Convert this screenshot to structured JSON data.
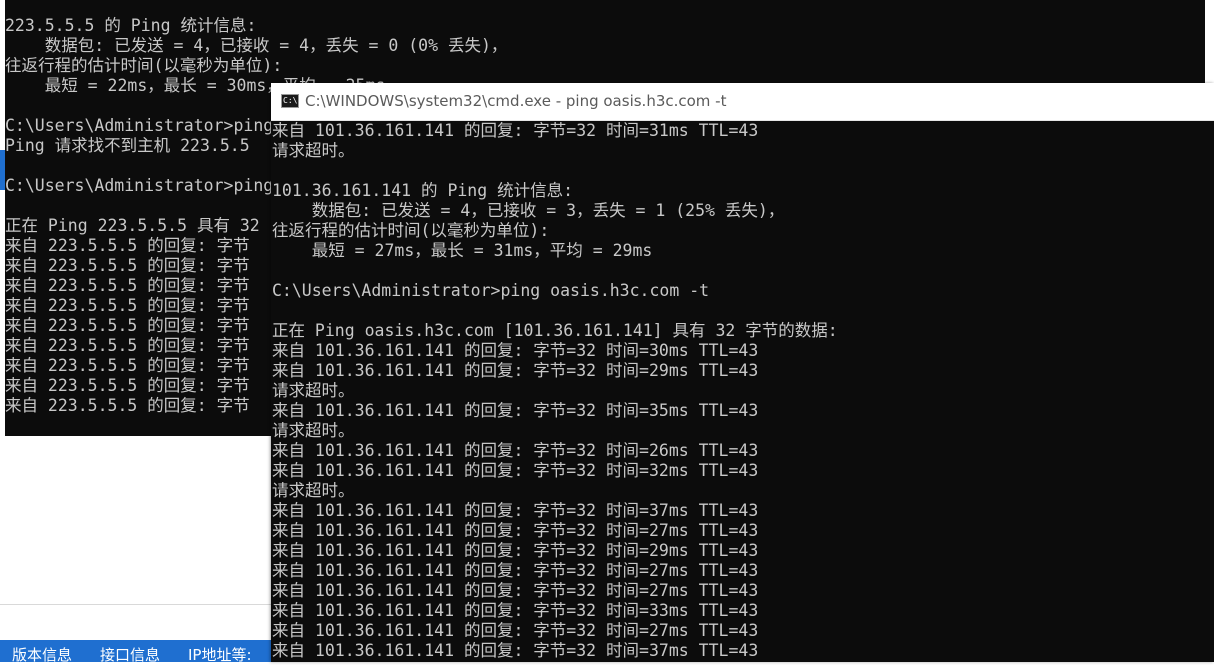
{
  "back_console": {
    "lines": [
      "223.5.5.5 的 Ping 统计信息:",
      "    数据包: 已发送 = 4，已接收 = 4，丢失 = 0 (0% 丢失)，",
      "往返行程的估计时间(以毫秒为单位):",
      "    最短 = 22ms，最长 = 30ms，平均 = 25ms",
      "",
      "C:\\Users\\Administrator>ping",
      "Ping 请求找不到主机 223.5.5",
      "",
      "C:\\Users\\Administrator>ping",
      "",
      "正在 Ping 223.5.5.5 具有 32",
      "来自 223.5.5.5 的回复: 字节",
      "来自 223.5.5.5 的回复: 字节",
      "来自 223.5.5.5 的回复: 字节",
      "来自 223.5.5.5 的回复: 字节",
      "来自 223.5.5.5 的回复: 字节",
      "来自 223.5.5.5 的回复: 字节",
      "来自 223.5.5.5 的回复: 字节",
      "来自 223.5.5.5 的回复: 字节",
      "来自 223.5.5.5 的回复: 字节"
    ]
  },
  "front_window": {
    "title": "C:\\WINDOWS\\system32\\cmd.exe - ping  oasis.h3c.com -t",
    "icon_label": "C:\\",
    "lines": [
      "来自 101.36.161.141 的回复: 字节=32 时间=31ms TTL=43",
      "请求超时。",
      "",
      "101.36.161.141 的 Ping 统计信息:",
      "    数据包: 已发送 = 4，已接收 = 3，丢失 = 1 (25% 丢失)，",
      "往返行程的估计时间(以毫秒为单位):",
      "    最短 = 27ms，最长 = 31ms，平均 = 29ms",
      "",
      "C:\\Users\\Administrator>ping oasis.h3c.com -t",
      "",
      "正在 Ping oasis.h3c.com [101.36.161.141] 具有 32 字节的数据:",
      "来自 101.36.161.141 的回复: 字节=32 时间=30ms TTL=43",
      "来自 101.36.161.141 的回复: 字节=32 时间=29ms TTL=43",
      "请求超时。",
      "来自 101.36.161.141 的回复: 字节=32 时间=35ms TTL=43",
      "请求超时。",
      "来自 101.36.161.141 的回复: 字节=32 时间=26ms TTL=43",
      "来自 101.36.161.141 的回复: 字节=32 时间=32ms TTL=43",
      "请求超时。",
      "来自 101.36.161.141 的回复: 字节=32 时间=37ms TTL=43",
      "来自 101.36.161.141 的回复: 字节=32 时间=27ms TTL=43",
      "来自 101.36.161.141 的回复: 字节=32 时间=29ms TTL=43",
      "来自 101.36.161.141 的回复: 字节=32 时间=27ms TTL=43",
      "来自 101.36.161.141 的回复: 字节=32 时间=27ms TTL=43",
      "来自 101.36.161.141 的回复: 字节=32 时间=33ms TTL=43",
      "来自 101.36.161.141 的回复: 字节=32 时间=27ms TTL=43",
      "来自 101.36.161.141 的回复: 字节=32 时间=37ms TTL=43"
    ]
  },
  "background_app": {
    "tabs": [
      "版本信息",
      "接口信息",
      "IP地址等:"
    ]
  },
  "colors": {
    "console_bg": "#0c0c0c",
    "console_text": "#c8c8c8",
    "accent_blue": "#1f6fd0"
  }
}
